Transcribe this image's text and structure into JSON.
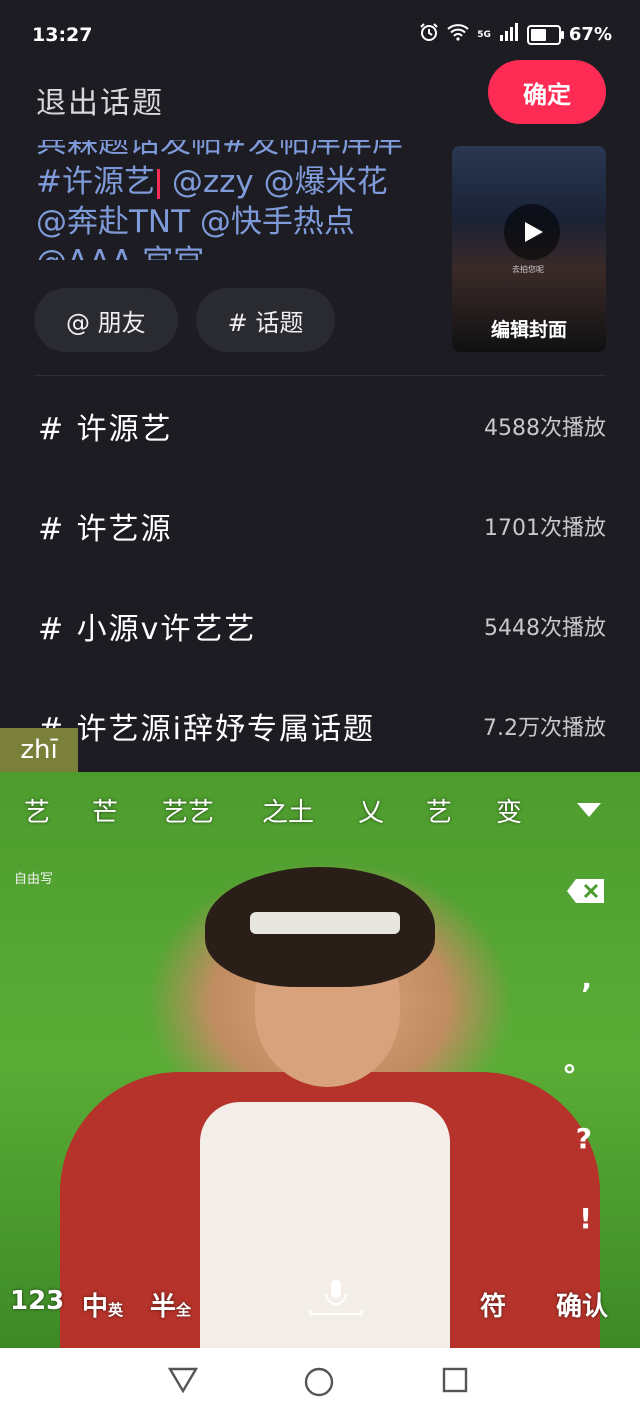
{
  "status_bar": {
    "time": "13:27",
    "network": "5G",
    "battery": "67%",
    "battery_level": 0.67
  },
  "header": {
    "exit_label": "退出话题",
    "confirm_label": "确定"
  },
  "editor": {
    "line1": "宾森题话发帖#发帖岸岸岸",
    "line2_before_cursor": "#许源艺",
    "line2_after_cursor": " @zzy @爆米花",
    "line3": "@奔赴TNT @快手热点",
    "line4": "@AAA 官官"
  },
  "cover": {
    "label": "编辑封面",
    "caption": "去拍您呢"
  },
  "chips": [
    {
      "label": "@ 朋友"
    },
    {
      "label": "# 话题"
    }
  ],
  "topics": [
    {
      "name": "# 许源艺",
      "plays": "4588次播放"
    },
    {
      "name": "# 许艺源",
      "plays": "1701次播放"
    },
    {
      "name": "# 小源v许艺艺",
      "plays": "5448次播放"
    },
    {
      "name": "# 许艺源i辞妤专属话题",
      "plays": "7.2万次播放"
    }
  ],
  "ime": {
    "pinyin": "zhī",
    "candidates": [
      "艺",
      "芒",
      "艺艺",
      "之土",
      "乂",
      "艺",
      "变"
    ],
    "free_writing": "自由写",
    "punctuation": [
      ",",
      "。",
      "?",
      "!"
    ],
    "bottom_keys": {
      "num": "123",
      "zh": "中",
      "en": "英",
      "half": "半",
      "full": "全",
      "symbol": "符",
      "confirm": "确认"
    }
  }
}
